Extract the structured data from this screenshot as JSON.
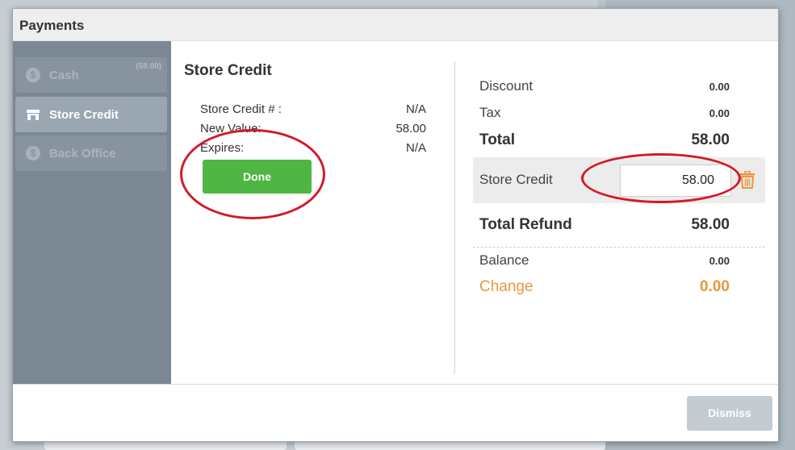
{
  "modal": {
    "title": "Payments"
  },
  "sidebar": {
    "items": [
      {
        "label": "Cash",
        "amount": "(58.00)",
        "icon": "dollar-icon"
      },
      {
        "label": "Store Credit",
        "icon": "store-icon"
      },
      {
        "label": "Back Office",
        "icon": "dollar-icon"
      }
    ]
  },
  "store_credit_panel": {
    "title": "Store Credit",
    "rows": [
      {
        "label": "Store Credit # :",
        "value": "N/A"
      },
      {
        "label": "New Value:",
        "value": "58.00"
      },
      {
        "label": "Expires:",
        "value": "N/A"
      }
    ],
    "done_label": "Done"
  },
  "summary": {
    "discount": {
      "label": "Discount",
      "value": "0.00"
    },
    "tax": {
      "label": "Tax",
      "value": "0.00"
    },
    "total": {
      "label": "Total",
      "value": "58.00"
    },
    "store_credit": {
      "label": "Store Credit",
      "value": "58.00"
    },
    "total_refund": {
      "label": "Total Refund",
      "value": "58.00"
    },
    "balance": {
      "label": "Balance",
      "value": "0.00"
    },
    "change": {
      "label": "Change",
      "value": "0.00"
    }
  },
  "footer": {
    "dismiss_label": "Dismiss"
  },
  "colors": {
    "accent_green": "#4fb643",
    "change_orange": "#e8983e",
    "annotation_red": "#d3192a",
    "sidebar": "#7b8893"
  }
}
